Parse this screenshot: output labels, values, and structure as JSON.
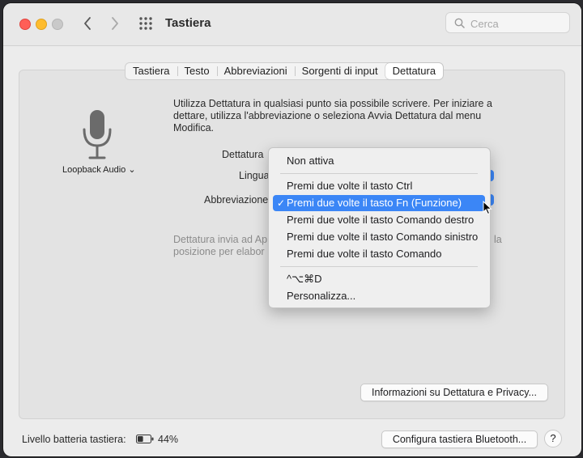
{
  "window": {
    "title": "Tastiera"
  },
  "search": {
    "placeholder": "Cerca"
  },
  "tabs": [
    {
      "label": "Tastiera"
    },
    {
      "label": "Testo"
    },
    {
      "label": "Abbreviazioni"
    },
    {
      "label": "Sorgenti di input"
    },
    {
      "label": "Dettatura",
      "active": true
    }
  ],
  "dictation": {
    "mic_source": "Loopback Audio ⌄",
    "description": "Utilizza Dettatura in qualsiasi punto sia possibile scrivere. Per iniziare a dettare, utilizza l'abbreviazione o seleziona Avvia Dettatura dal menu Modifica.",
    "label_dictation": "Dettatura",
    "label_language": "Lingua",
    "label_shortcut": "Abbreviazione",
    "note_visible": "Dettatura invia ad Ap",
    "note_visible2": "posizione per elabor",
    "note_tail": "la"
  },
  "menu": {
    "items": [
      {
        "label": "Non attiva"
      },
      {
        "label": "Premi due volte il tasto Ctrl"
      },
      {
        "label": "Premi due volte il tasto Fn (Funzione)",
        "selected": true
      },
      {
        "label": "Premi due volte il tasto Comando destro"
      },
      {
        "label": "Premi due volte il tasto Comando sinistro"
      },
      {
        "label": "Premi due volte il tasto Comando"
      },
      {
        "label": "^⌥⌘D"
      },
      {
        "label": "Personalizza..."
      }
    ],
    "check": "✓"
  },
  "buttons": {
    "privacy": "Informazioni su Dettatura e Privacy...",
    "bluetooth": "Configura tastiera Bluetooth...",
    "help": "?"
  },
  "footer": {
    "battery_label": "Livello batteria tastiera:",
    "battery_percent": "44%",
    "battery_level": 0.44
  },
  "colors": {
    "accent": "#3b86f6"
  }
}
